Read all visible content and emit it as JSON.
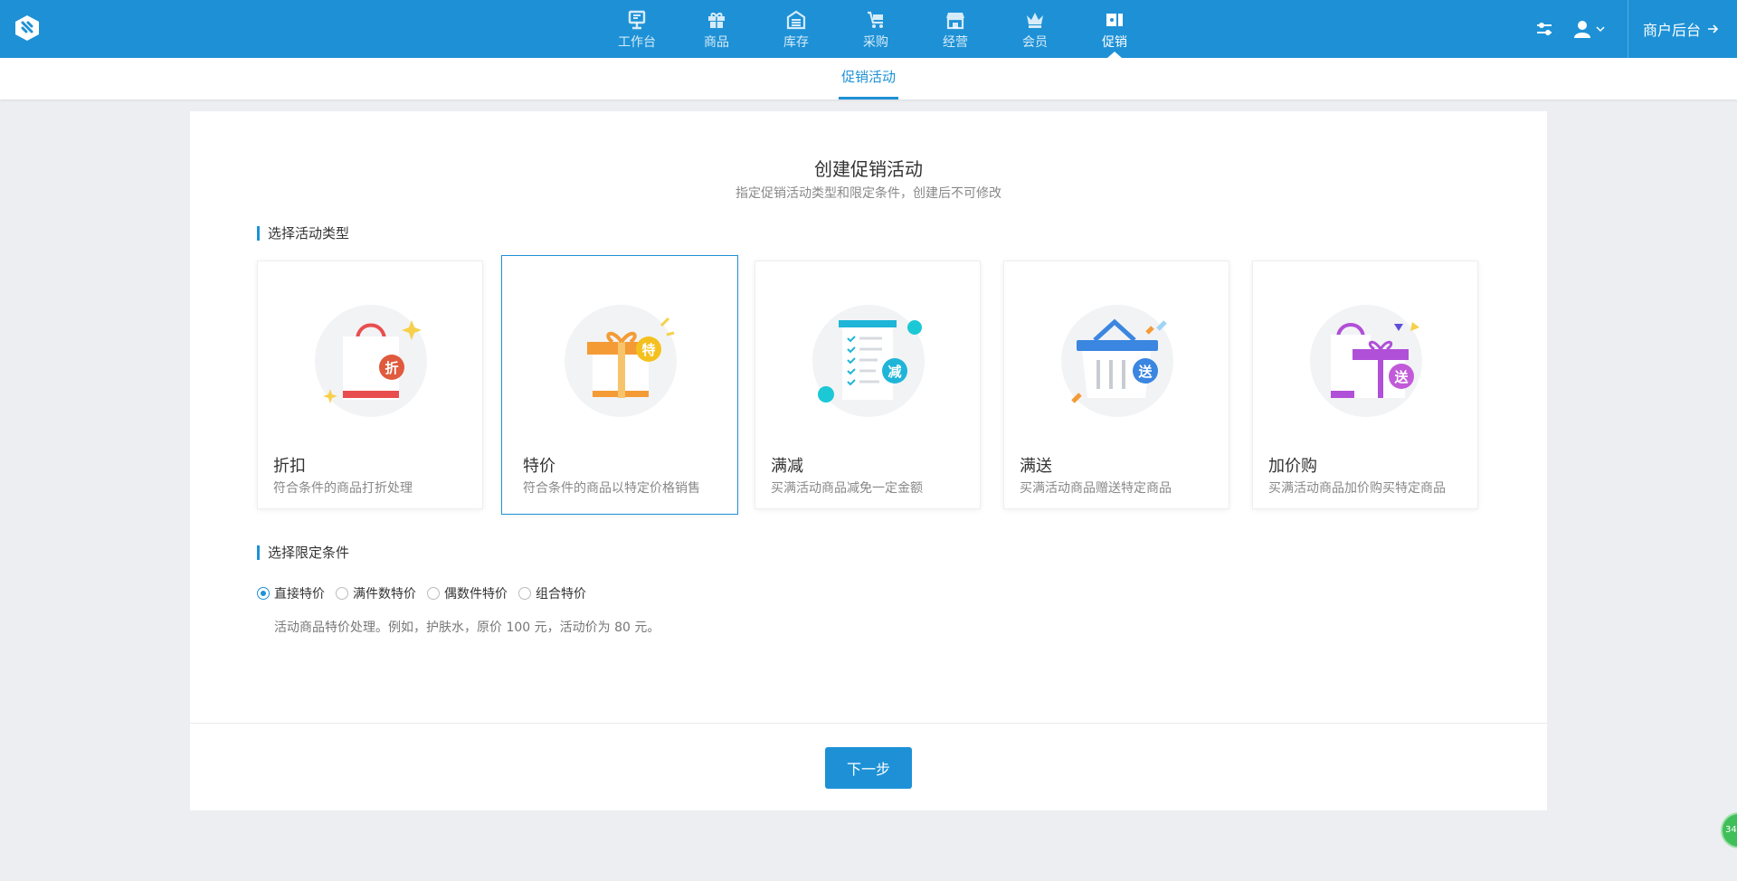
{
  "nav": {
    "items": [
      {
        "label": "工作台",
        "icon": "workbench-icon"
      },
      {
        "label": "商品",
        "icon": "goods-icon"
      },
      {
        "label": "库存",
        "icon": "warehouse-icon"
      },
      {
        "label": "采购",
        "icon": "cart-icon"
      },
      {
        "label": "经营",
        "icon": "store-icon"
      },
      {
        "label": "会员",
        "icon": "crown-icon"
      },
      {
        "label": "促销",
        "icon": "coupon-icon"
      }
    ],
    "active_index": 6,
    "merchant_label": "商户后台"
  },
  "subnav": {
    "tab": "促销活动"
  },
  "page": {
    "title": "创建促销活动",
    "subtitle": "指定促销活动类型和限定条件，创建后不可修改"
  },
  "sections": {
    "type_title": "选择活动类型",
    "condition_title": "选择限定条件"
  },
  "types": [
    {
      "name": "折扣",
      "desc": "符合条件的商品打折处理",
      "badge": "折"
    },
    {
      "name": "特价",
      "desc": "符合条件的商品以特定价格销售",
      "badge": "特"
    },
    {
      "name": "满减",
      "desc": "买满活动商品减免一定金额",
      "badge": "减"
    },
    {
      "name": "满送",
      "desc": "买满活动商品赠送特定商品",
      "badge": "送"
    },
    {
      "name": "加价购",
      "desc": "买满活动商品加价购买特定商品",
      "badge": "送"
    }
  ],
  "selected_type_index": 1,
  "conditions": {
    "options": [
      "直接特价",
      "满件数特价",
      "偶数件特价",
      "组合特价"
    ],
    "selected_index": 0,
    "description": "活动商品特价处理。例如，护肤水，原价 100 元，活动价为 80 元。"
  },
  "next_button": "下一步",
  "float_badge": "34",
  "colors": {
    "primary": "#1e91d6",
    "background": "#eceef1"
  }
}
